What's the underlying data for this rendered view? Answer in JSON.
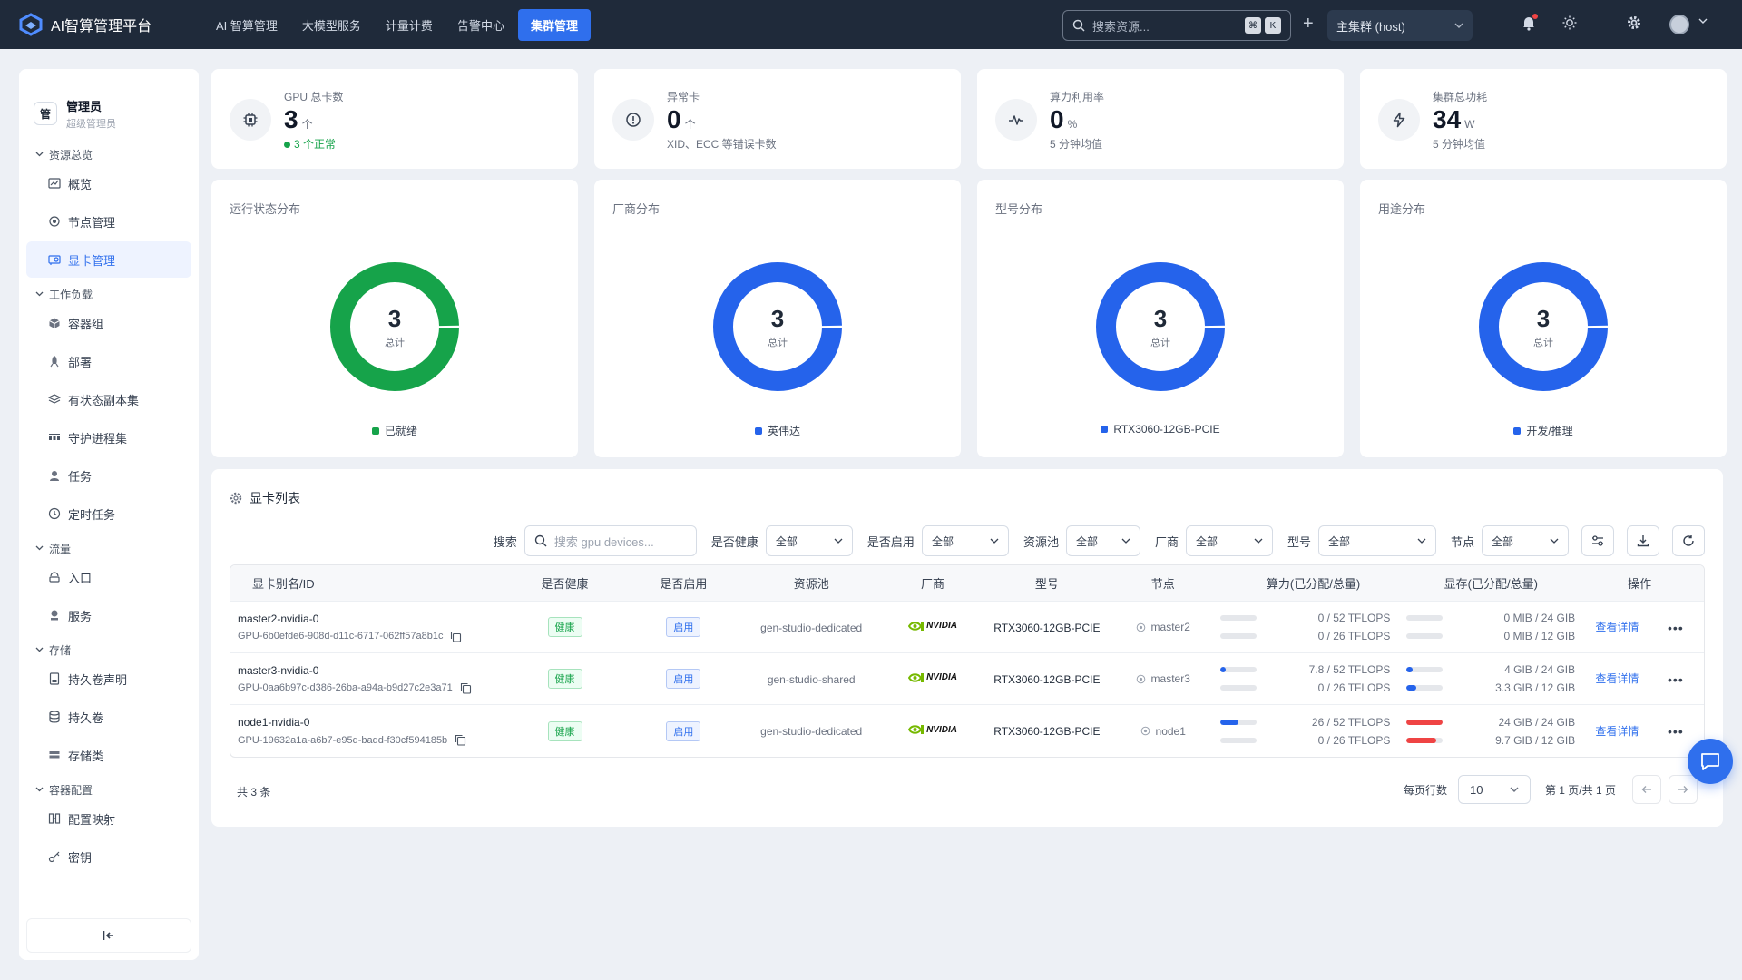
{
  "app": {
    "title": "AI智算管理平台"
  },
  "nav": [
    {
      "label": "AI 智算管理",
      "active": false
    },
    {
      "label": "大模型服务",
      "active": false
    },
    {
      "label": "计量计费",
      "active": false
    },
    {
      "label": "告警中心",
      "active": false
    },
    {
      "label": "集群管理",
      "active": true
    }
  ],
  "topbar": {
    "search_placeholder": "搜索资源...",
    "kbd": [
      "⌘",
      "K"
    ],
    "cluster": "主集群 (host)"
  },
  "user": {
    "badge": "管",
    "name": "管理员",
    "role": "超级管理员"
  },
  "sidebar": {
    "groups": [
      {
        "title": "资源总览",
        "items": [
          {
            "label": "概览",
            "icon": "chart-icon",
            "active": false
          },
          {
            "label": "节点管理",
            "icon": "node-icon",
            "active": false
          },
          {
            "label": "显卡管理",
            "icon": "gpu-icon",
            "active": true
          }
        ]
      },
      {
        "title": "工作负载",
        "items": [
          {
            "label": "容器组",
            "icon": "cube-icon",
            "active": false
          },
          {
            "label": "部署",
            "icon": "rocket-icon",
            "active": false
          },
          {
            "label": "有状态副本集",
            "icon": "layers-icon",
            "active": false
          },
          {
            "label": "守护进程集",
            "icon": "daemon-icon",
            "active": false
          },
          {
            "label": "任务",
            "icon": "task-icon",
            "active": false
          },
          {
            "label": "定时任务",
            "icon": "clock-icon",
            "active": false
          }
        ]
      },
      {
        "title": "流量",
        "items": [
          {
            "label": "入口",
            "icon": "ingress-icon",
            "active": false
          },
          {
            "label": "服务",
            "icon": "service-icon",
            "active": false
          }
        ]
      },
      {
        "title": "存储",
        "items": [
          {
            "label": "持久卷声明",
            "icon": "pvc-icon",
            "active": false
          },
          {
            "label": "持久卷",
            "icon": "database-icon",
            "active": false
          },
          {
            "label": "存储类",
            "icon": "storage-icon",
            "active": false
          }
        ]
      },
      {
        "title": "容器配置",
        "items": [
          {
            "label": "配置映射",
            "icon": "configmap-icon",
            "active": false
          },
          {
            "label": "密钥",
            "icon": "key-icon",
            "active": false
          }
        ]
      }
    ],
    "collapse_icon": "collapse-left-icon"
  },
  "stats": [
    {
      "label": "GPU 总卡数",
      "value": "3",
      "unit": "个",
      "sub": "3 个正常",
      "sub_color": "green",
      "icon": "chip-icon"
    },
    {
      "label": "异常卡",
      "value": "0",
      "unit": "个",
      "sub": "XID、ECC 等错误卡数",
      "sub_color": "gray",
      "icon": "alert-icon"
    },
    {
      "label": "算力利用率",
      "value": "0",
      "unit": "%",
      "sub": "5 分钟均值",
      "sub_color": "gray",
      "icon": "pulse-icon"
    },
    {
      "label": "集群总功耗",
      "value": "34",
      "unit": "W",
      "sub": "5 分钟均值",
      "sub_color": "gray",
      "icon": "bolt-icon"
    }
  ],
  "donuts": [
    {
      "title": "运行状态分布",
      "total": "3",
      "total_label": "总计",
      "legend": "已就绪",
      "color": "#16a34a"
    },
    {
      "title": "厂商分布",
      "total": "3",
      "total_label": "总计",
      "legend": "英伟达",
      "color": "#2563eb"
    },
    {
      "title": "型号分布",
      "total": "3",
      "total_label": "总计",
      "legend": "RTX3060-12GB-PCIE",
      "color": "#2563eb"
    },
    {
      "title": "用途分布",
      "total": "3",
      "total_label": "总计",
      "legend": "开发/推理",
      "color": "#2563eb"
    }
  ],
  "table": {
    "title": "显卡列表",
    "filters": {
      "search_label": "搜索",
      "search_placeholder": "搜索 gpu devices...",
      "selects": [
        {
          "label": "是否健康",
          "value": "全部"
        },
        {
          "label": "是否启用",
          "value": "全部"
        },
        {
          "label": "资源池",
          "value": "全部"
        },
        {
          "label": "厂商",
          "value": "全部"
        },
        {
          "label": "型号",
          "value": "全部"
        },
        {
          "label": "节点",
          "value": "全部"
        }
      ]
    },
    "columns": [
      "显卡别名/ID",
      "是否健康",
      "是否启用",
      "资源池",
      "厂商",
      "型号",
      "节点",
      "算力(已分配/总量)",
      "显存(已分配/总量)",
      "操作"
    ],
    "rows": [
      {
        "name": "master2-nvidia-0",
        "uuid": "GPU-6b0efde6-908d-d11c-6717-062ff57a8b1c",
        "health": "健康",
        "enabled": "启用",
        "pool": "gen-studio-dedicated",
        "vendor": "NVIDIA",
        "model": "RTX3060-12GB-PCIE",
        "node": "master2",
        "compute": [
          {
            "text": "0 / 52 TFLOPS",
            "ratio": 0,
            "color": "#2563eb"
          },
          {
            "text": "0 / 26 TFLOPS",
            "ratio": 0,
            "color": "#2563eb"
          }
        ],
        "memory": [
          {
            "text": "0 MIB / 24 GIB",
            "ratio": 0,
            "color": "#2563eb"
          },
          {
            "text": "0 MIB / 12 GIB",
            "ratio": 0,
            "color": "#2563eb"
          }
        ],
        "action": "查看详情"
      },
      {
        "name": "master3-nvidia-0",
        "uuid": "GPU-0aa6b97c-d386-26ba-a94a-b9d27c2e3a71",
        "health": "健康",
        "enabled": "启用",
        "pool": "gen-studio-shared",
        "vendor": "NVIDIA",
        "model": "RTX3060-12GB-PCIE",
        "node": "master3",
        "compute": [
          {
            "text": "7.8 / 52 TFLOPS",
            "ratio": 0.15,
            "color": "#2563eb"
          },
          {
            "text": "0 / 26 TFLOPS",
            "ratio": 0,
            "color": "#2563eb"
          }
        ],
        "memory": [
          {
            "text": "4 GIB / 24 GIB",
            "ratio": 0.167,
            "color": "#2563eb"
          },
          {
            "text": "3.3 GIB / 12 GIB",
            "ratio": 0.275,
            "color": "#2563eb"
          }
        ],
        "action": "查看详情"
      },
      {
        "name": "node1-nvidia-0",
        "uuid": "GPU-19632a1a-a6b7-e95d-badd-f30cf594185b",
        "health": "健康",
        "enabled": "启用",
        "pool": "gen-studio-dedicated",
        "vendor": "NVIDIA",
        "model": "RTX3060-12GB-PCIE",
        "node": "node1",
        "compute": [
          {
            "text": "26 / 52 TFLOPS",
            "ratio": 0.5,
            "color": "#2563eb"
          },
          {
            "text": "0 / 26 TFLOPS",
            "ratio": 0,
            "color": "#2563eb"
          }
        ],
        "memory": [
          {
            "text": "24 GIB / 24 GIB",
            "ratio": 1.0,
            "color": "#ef4444"
          },
          {
            "text": "9.7 GIB / 12 GIB",
            "ratio": 0.81,
            "color": "#ef4444"
          }
        ],
        "action": "查看详情"
      }
    ],
    "total": "共 3 条",
    "page_size_label": "每页行数",
    "page_size": "10",
    "page_info": "第 1 页/共 1 页"
  },
  "colors": {
    "accent": "#2f6fed",
    "topbar": "#1f2a3a",
    "healthy": "#16a34a",
    "danger": "#ef4444"
  }
}
